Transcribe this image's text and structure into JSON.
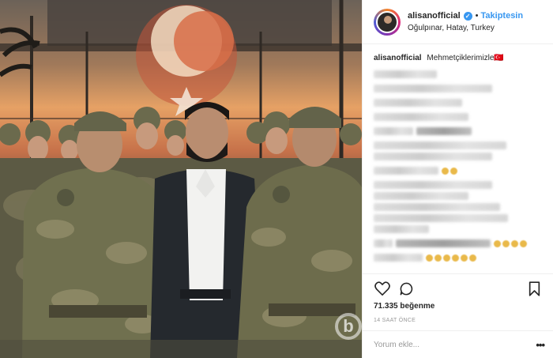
{
  "header": {
    "username": "alisanofficial",
    "verified_icon": "verified-badge-icon",
    "separator": "•",
    "follow_label": "Takiptesin",
    "location": "Oğulpınar, Hatay, Turkey"
  },
  "caption": {
    "username": "alisanofficial",
    "text": "Mehmetçiklerimizle🇹🇷"
  },
  "actions": {
    "like_icon": "heart-icon",
    "comment_icon": "comment-icon",
    "save_icon": "bookmark-icon"
  },
  "likes_text": "71.335 beğenme",
  "timestamp": "14 SAAT ÖNCE",
  "comment_input": {
    "placeholder": "Yorum ekle..."
  },
  "more_label": "•••",
  "watermark": {
    "letter": "b"
  },
  "colors": {
    "link": "#3897f0",
    "muted": "#999999",
    "text": "#262626",
    "flag_red": "#e30a17"
  }
}
